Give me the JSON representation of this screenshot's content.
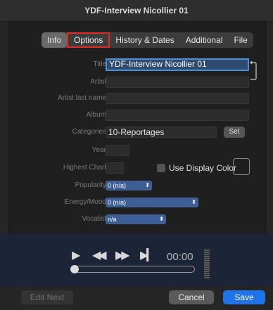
{
  "window": {
    "title": "YDF-Interview Nicollier 01"
  },
  "tabs": [
    {
      "label": "Info",
      "state": "active"
    },
    {
      "label": "Options",
      "state": "highlighted"
    },
    {
      "label": "History & Dates"
    },
    {
      "label": "Additional"
    },
    {
      "label": "File"
    }
  ],
  "form": {
    "title_label": "Title",
    "title_value": "YDF-Interview Nicollier 01",
    "artist_label": "Artist",
    "artist_value": "",
    "artist_last_name_label": "Artist last name",
    "artist_last_name_value": "",
    "album_label": "Album",
    "album_value": "",
    "categories_label": "Categories",
    "categories_value": "10-Reportages",
    "set_button": "Set",
    "year_label": "Year",
    "year_value": "",
    "highest_chart_label": "Highest Chart",
    "highest_chart_value": "",
    "use_display_color_label": "Use Display Color",
    "popularity_label": "Popularity",
    "popularity_value": "0 (n/a)",
    "energy_label": "Energy/Mood",
    "energy_value": "0 (n/a)",
    "vocalist_label": "Vocalist",
    "vocalist_value": "n/a"
  },
  "player": {
    "time": "00:00",
    "progress_percent": 0,
    "icons": [
      "play-icon",
      "rewind-icon",
      "fast-forward-icon",
      "skip-to-end-icon"
    ]
  },
  "footer": {
    "edit_next": "Edit Next",
    "cancel": "Cancel",
    "save": "Save"
  },
  "colors": {
    "accent": "#1f73e8",
    "highlight_box": "#e02a22",
    "popup_blue": "#3e5f96",
    "focus_field": "#2f4a6e"
  }
}
